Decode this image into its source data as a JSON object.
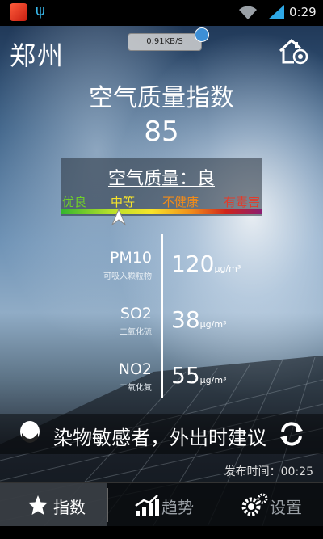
{
  "status_bar": {
    "time": "0:29"
  },
  "header": {
    "city": "郑州",
    "net_speed": "0.91KB/S"
  },
  "aqi": {
    "title": "空气质量指数",
    "value": "85",
    "quality_label": "空气质量：良",
    "scale_levels": [
      "优良",
      "中等",
      "不健康",
      "有毒害"
    ],
    "scale_colors": [
      "#6fcf2a",
      "#f4e22c",
      "#f08b1a",
      "#e33b2a"
    ]
  },
  "pollutants": [
    {
      "name": "PM10",
      "desc": "可吸入颗粒物",
      "value": "120",
      "unit": "μg/m³"
    },
    {
      "name": "SO2",
      "desc": "二氧化硫",
      "value": "38",
      "unit": "μg/m³"
    },
    {
      "name": "NO2",
      "desc": "二氧化氮",
      "value": "55",
      "unit": "μg/m³"
    }
  ],
  "advice": {
    "text": "染物敏感者，外出时建议"
  },
  "publish": {
    "label": "发布时间：00:25"
  },
  "nav": {
    "tabs": [
      {
        "label": "指数",
        "icon": "star-icon",
        "active": true
      },
      {
        "label": "趋势",
        "icon": "trend-chart-icon",
        "active": false
      },
      {
        "label": "设置",
        "icon": "gear-icon",
        "active": false
      }
    ]
  }
}
